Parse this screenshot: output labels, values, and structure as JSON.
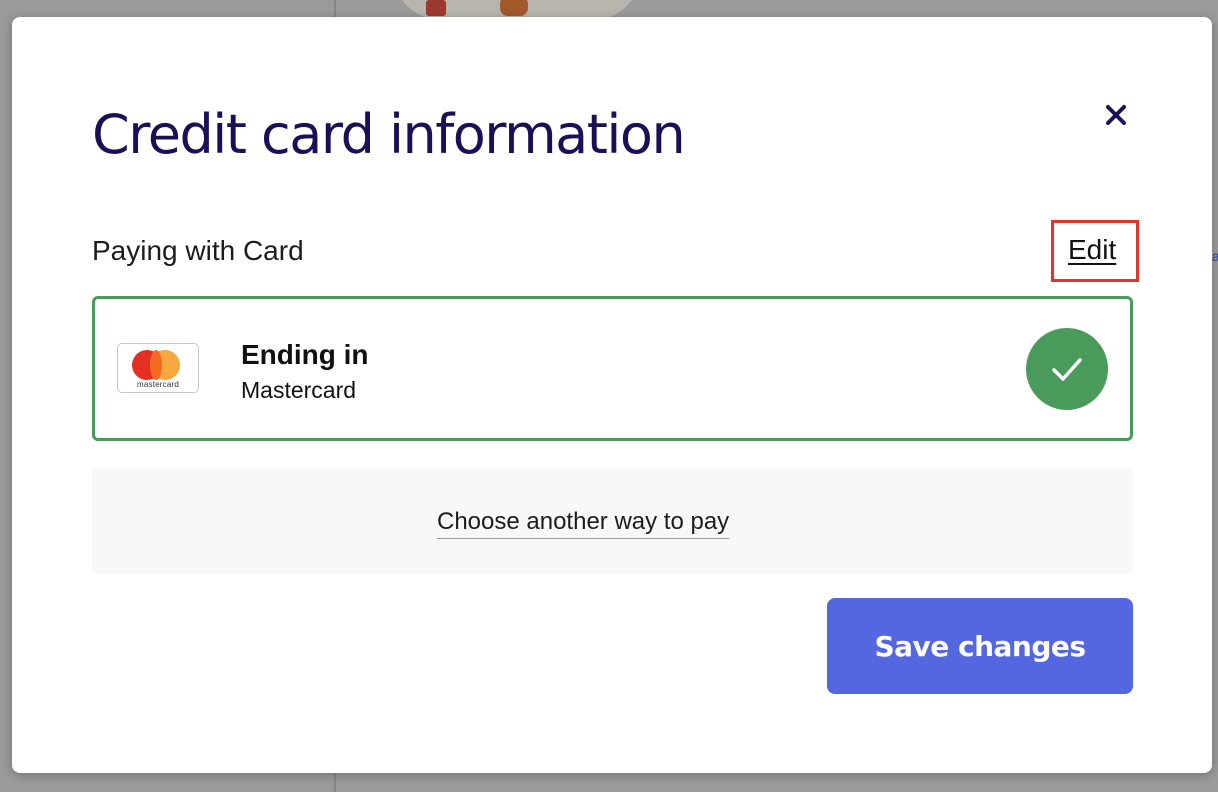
{
  "modal": {
    "title": "Credit card information",
    "close_icon": "close-icon",
    "subtitle": "Paying with Card",
    "edit_label": "Edit",
    "card": {
      "brand_logo_text": "mastercard",
      "title": "Ending in",
      "subtitle": "Mastercard",
      "selected": true,
      "check_icon": "check-circle-icon"
    },
    "alt_pay_label": "Choose another way to pay",
    "save_label": "Save changes"
  },
  "colors": {
    "title": "#1a1057",
    "selected_border": "#4a9a5b",
    "primary_button": "#5466e0",
    "highlight_box": "#e0352b"
  }
}
